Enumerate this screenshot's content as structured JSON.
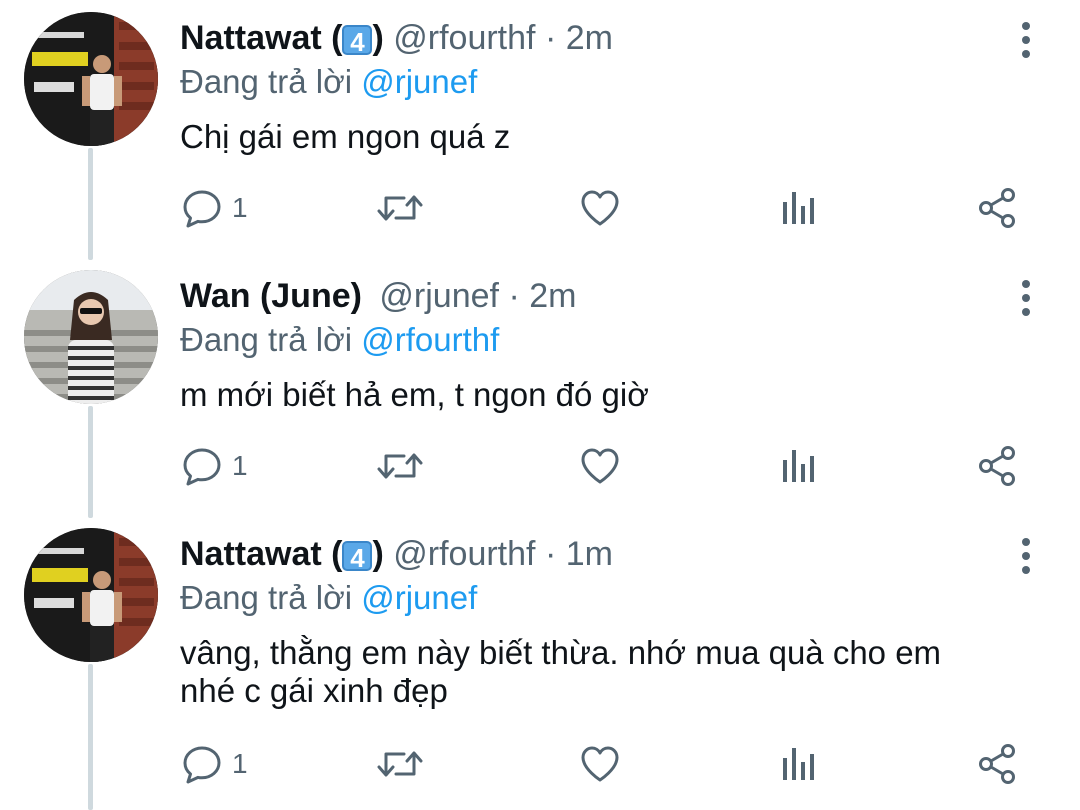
{
  "colors": {
    "text": "#0f1419",
    "secondary": "#536471",
    "accent": "#1d9bf0",
    "thread_line": "#cfd9de"
  },
  "tweets": [
    {
      "name": "Nattawat (",
      "badge": "4",
      "name_close": ")",
      "handle": "@rfourthf",
      "dot": "·",
      "time": "2m",
      "replying_label": "Đang trả lời",
      "replying_to": "@rjunef",
      "text": "Chị gái em ngon quá z",
      "reply_count": "1"
    },
    {
      "name": "Wan (June)",
      "badge": "",
      "name_close": "",
      "handle": "@rjunef",
      "dot": "·",
      "time": "2m",
      "replying_label": "Đang trả lời",
      "replying_to": "@rfourthf",
      "text": "m mới biết hả em, t ngon đó giờ",
      "reply_count": "1"
    },
    {
      "name": "Nattawat (",
      "badge": "4",
      "name_close": ")",
      "handle": "@rfourthf",
      "dot": "·",
      "time": "1m",
      "replying_label": "Đang trả lời",
      "replying_to": "@rjunef",
      "text": "vâng, thằng em này biết thừa. nhớ mua quà cho em nhé c gái xinh đẹp",
      "reply_count": "1"
    }
  ],
  "icons": {
    "reply": "reply-icon",
    "retweet": "retweet-icon",
    "like": "heart-icon",
    "analytics": "analytics-icon",
    "share": "share-icon",
    "more": "more-vertical-icon"
  }
}
